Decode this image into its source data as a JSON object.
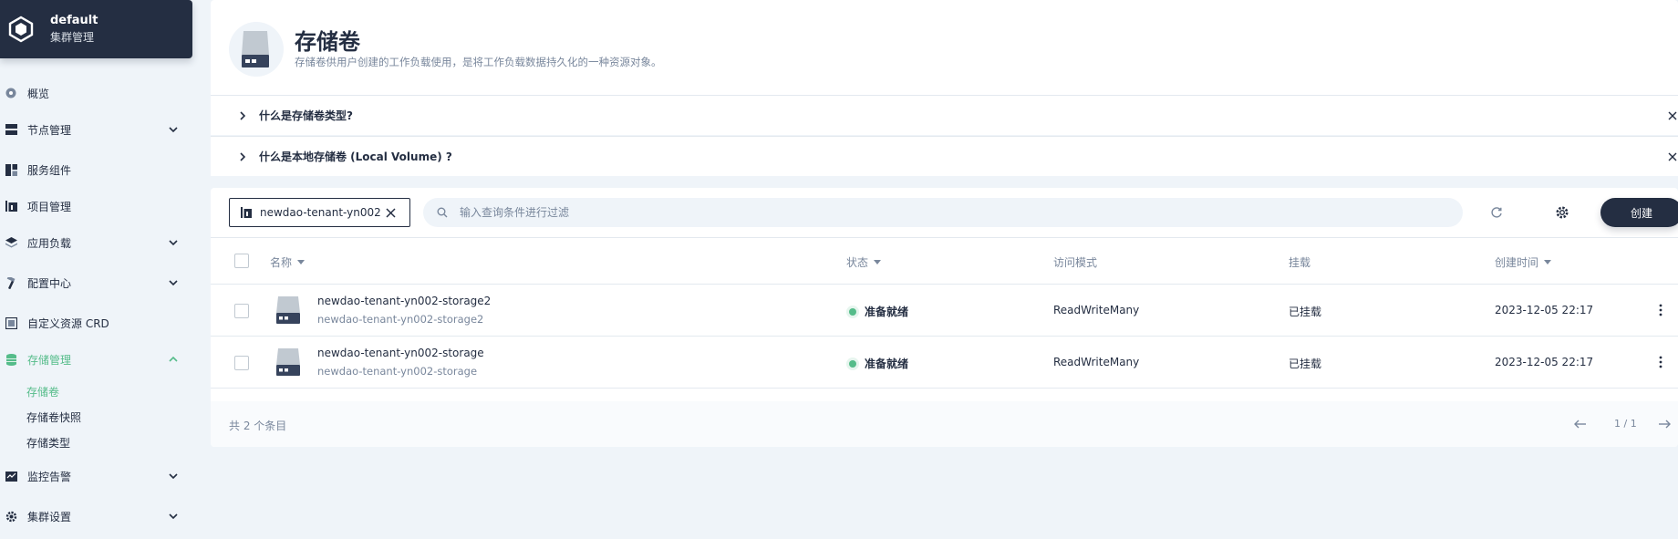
{
  "cluster": {
    "name": "default",
    "subtitle": "集群管理"
  },
  "sidebar": {
    "items": [
      {
        "label": "概览",
        "icon": "dashboard-icon",
        "expandable": false
      },
      {
        "label": "节点管理",
        "icon": "nodes-icon",
        "expandable": true
      },
      {
        "label": "服务组件",
        "icon": "components-icon",
        "expandable": false
      },
      {
        "label": "项目管理",
        "icon": "project-icon",
        "expandable": false
      },
      {
        "label": "应用负载",
        "icon": "layers-icon",
        "expandable": true
      },
      {
        "label": "配置中心",
        "icon": "hammer-icon",
        "expandable": true
      },
      {
        "label": "自定义资源 CRD",
        "icon": "crd-icon",
        "expandable": false
      },
      {
        "label": "存储管理",
        "icon": "database-icon",
        "expandable": true,
        "active": true
      },
      {
        "label": "监控告警",
        "icon": "monitor-icon",
        "expandable": true
      },
      {
        "label": "集群设置",
        "icon": "gear-icon",
        "expandable": true
      }
    ],
    "storage_sub": [
      {
        "label": "存储卷",
        "active": true
      },
      {
        "label": "存储卷快照",
        "active": false
      },
      {
        "label": "存储类型",
        "active": false
      }
    ]
  },
  "header": {
    "title": "存储卷",
    "description": "存储卷供用户创建的工作负载使用，是将工作负载数据持久化的一种资源对象。"
  },
  "faq": [
    {
      "text": "什么是存储卷类型?"
    },
    {
      "text": "什么是本地存储卷 (Local Volume) ?"
    }
  ],
  "toolbar": {
    "namespace": "newdao-tenant-yn002",
    "search_placeholder": "输入查询条件进行过滤",
    "create_label": "创建"
  },
  "table": {
    "columns": {
      "name": "名称",
      "status": "状态",
      "access": "访问模式",
      "mount": "挂载",
      "created": "创建时间"
    },
    "rows": [
      {
        "name": "newdao-tenant-yn002-storage2",
        "sub": "newdao-tenant-yn002-storage2",
        "status": "准备就绪",
        "access": "ReadWriteMany",
        "mount": "已挂载",
        "created": "2023-12-05 22:17"
      },
      {
        "name": "newdao-tenant-yn002-storage",
        "sub": "newdao-tenant-yn002-storage",
        "status": "准备就绪",
        "access": "ReadWriteMany",
        "mount": "已挂载",
        "created": "2023-12-05 22:17"
      }
    ]
  },
  "footer": {
    "total": "共 2 个条目",
    "page": "1 / 1"
  },
  "colors": {
    "accent": "#55bc8a",
    "dark": "#242e42",
    "muted": "#79879c"
  }
}
